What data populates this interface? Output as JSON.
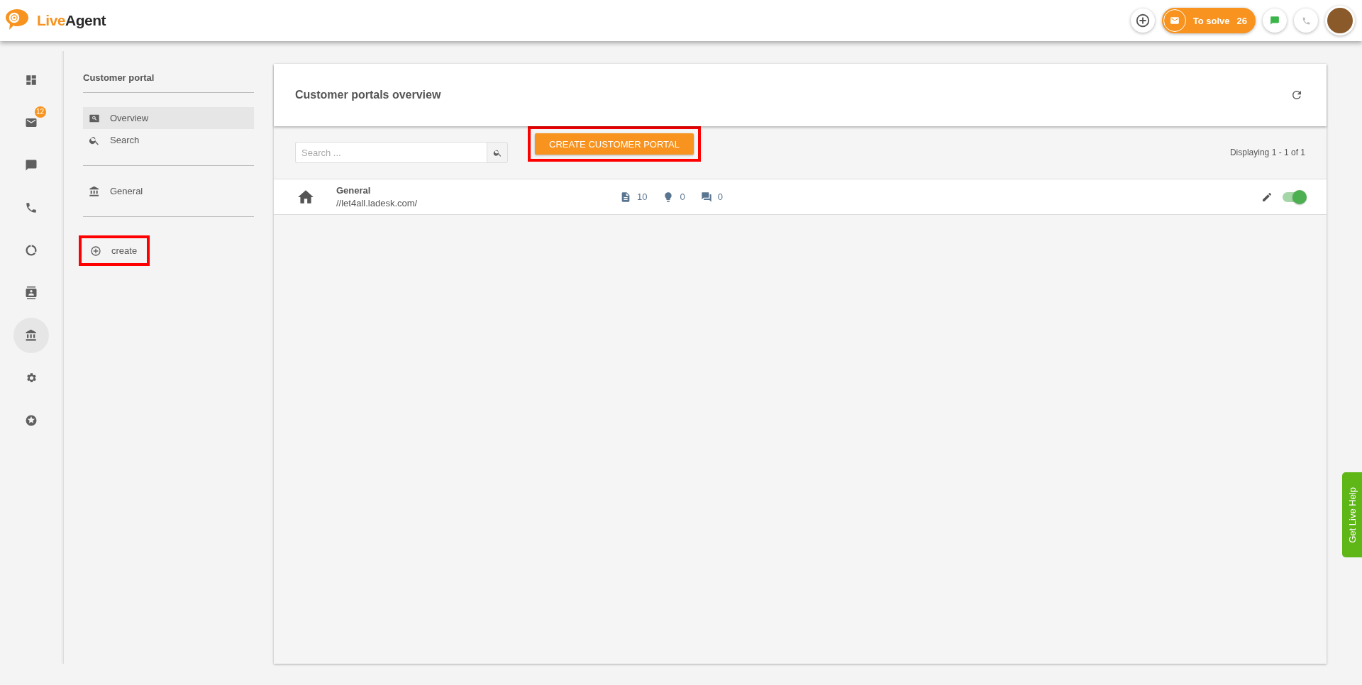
{
  "header": {
    "logo_text": [
      "Live",
      "Agent"
    ],
    "to_solve": {
      "label": "To solve",
      "count": "26"
    }
  },
  "rail": [
    {
      "selected": false
    },
    {
      "selected": false,
      "badge": "12"
    },
    {
      "selected": false
    },
    {
      "selected": false
    },
    {
      "selected": false
    },
    {
      "selected": false
    },
    {
      "selected": true
    },
    {
      "selected": false
    },
    {
      "selected": false
    }
  ],
  "submenu": {
    "title": "Customer portal",
    "groups": [
      [
        {
          "label": "Overview",
          "selected": true,
          "highlighted": false
        },
        {
          "label": "Search",
          "selected": false,
          "highlighted": false
        }
      ],
      [
        {
          "label": "General",
          "selected": false,
          "highlighted": false
        }
      ],
      [
        {
          "label": "create",
          "selected": false,
          "highlighted": true
        }
      ]
    ]
  },
  "panel": {
    "title": "Customer portals overview",
    "search": {
      "placeholder": "Search ..."
    },
    "create_button": {
      "label": "CREATE CUSTOMER PORTAL",
      "highlighted": true
    },
    "paging": "Displaying 1 - 1 of 1",
    "rows": [
      {
        "name": "General",
        "url": "//let4all.ladesk.com/",
        "articles": "10",
        "ideas": "0",
        "forum": "0",
        "on": true
      }
    ]
  },
  "help_tab": "Get Live Help"
}
